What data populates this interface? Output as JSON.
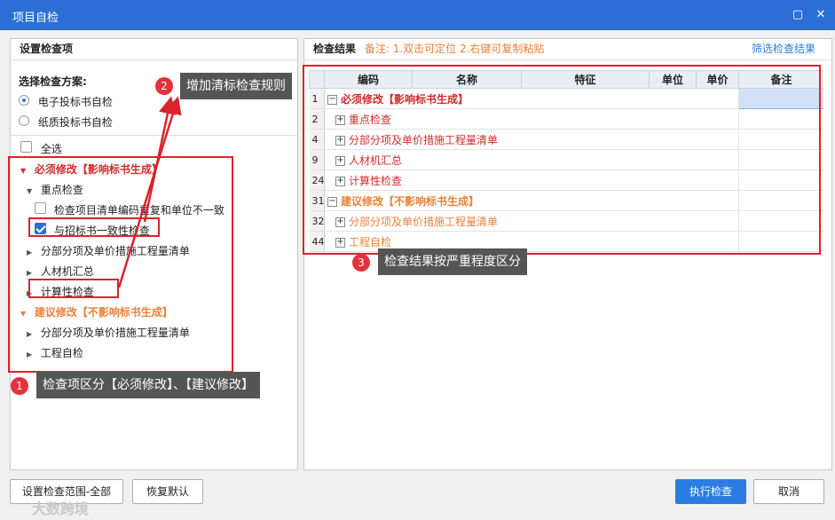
{
  "window": {
    "title": "项目自检",
    "restore_glyph": "▢",
    "close_glyph": "✕"
  },
  "left": {
    "title": "设置检查项",
    "scheme_label": "选择检查方案:",
    "radio": [
      {
        "label": "电子投标书自检",
        "selected": true
      },
      {
        "label": "纸质投标书自检",
        "selected": false
      }
    ],
    "select_all": "全选",
    "tree": {
      "group1": "必须修改【影响标书生成】",
      "g1_key": "重点检查",
      "g1_key_item1": "检查项目清单编码重复和单位不一致",
      "g1_key_item2": "与招标书一致性检查",
      "g1_sub1": "分部分项及单价措施工程量清单",
      "g1_sub2": "人材机汇总",
      "g1_sub3": "计算性检查",
      "group2": "建议修改【不影响标书生成】",
      "g2_sub1": "分部分项及单价措施工程量清单",
      "g2_sub2": "工程自检"
    }
  },
  "right": {
    "title": "检查结果",
    "note": "备注: 1.双击可定位 2.右键可复制粘贴",
    "filter_link": "筛选检查结果",
    "columns": [
      "",
      "编码",
      "名称",
      "特征",
      "单位",
      "单价",
      "备注"
    ],
    "rows": [
      {
        "num": "1",
        "text": "必须修改【影响标书生成】",
        "level": 0,
        "style": "red",
        "exp": "−"
      },
      {
        "num": "2",
        "text": "重点检查",
        "level": 1,
        "style": "red-normal",
        "exp": "+"
      },
      {
        "num": "4",
        "text": "分部分项及单价措施工程量清单",
        "level": 1,
        "style": "red-normal",
        "exp": "+"
      },
      {
        "num": "9",
        "text": "人材机汇总",
        "level": 1,
        "style": "red-normal",
        "exp": "+"
      },
      {
        "num": "24",
        "text": "计算性检查",
        "level": 1,
        "style": "red-normal",
        "exp": "+"
      },
      {
        "num": "31",
        "text": "建议修改【不影响标书生成】",
        "level": 0,
        "style": "orange",
        "exp": "−"
      },
      {
        "num": "32",
        "text": "分部分项及单价措施工程量清单",
        "level": 1,
        "style": "orange-normal",
        "exp": "+"
      },
      {
        "num": "44",
        "text": "工程自检",
        "level": 1,
        "style": "orange-normal",
        "exp": "+"
      }
    ]
  },
  "annotations": {
    "a1": {
      "num": "1",
      "text": "检查项区分【必须修改】、【建议修改】"
    },
    "a2": {
      "num": "2",
      "text": "增加清标检查规则"
    },
    "a3": {
      "num": "3",
      "text": "检查结果按严重程度区分"
    }
  },
  "buttons": {
    "set_scope": "设置检查范围-全部",
    "restore": "恢复默认",
    "execute": "执行检查",
    "cancel": "取消"
  },
  "watermark": "大数跨境",
  "colors": {
    "accent": "#2b6fd6",
    "must": "#d12b2b",
    "suggest": "#e8813a",
    "highlight": "#d9242e"
  }
}
